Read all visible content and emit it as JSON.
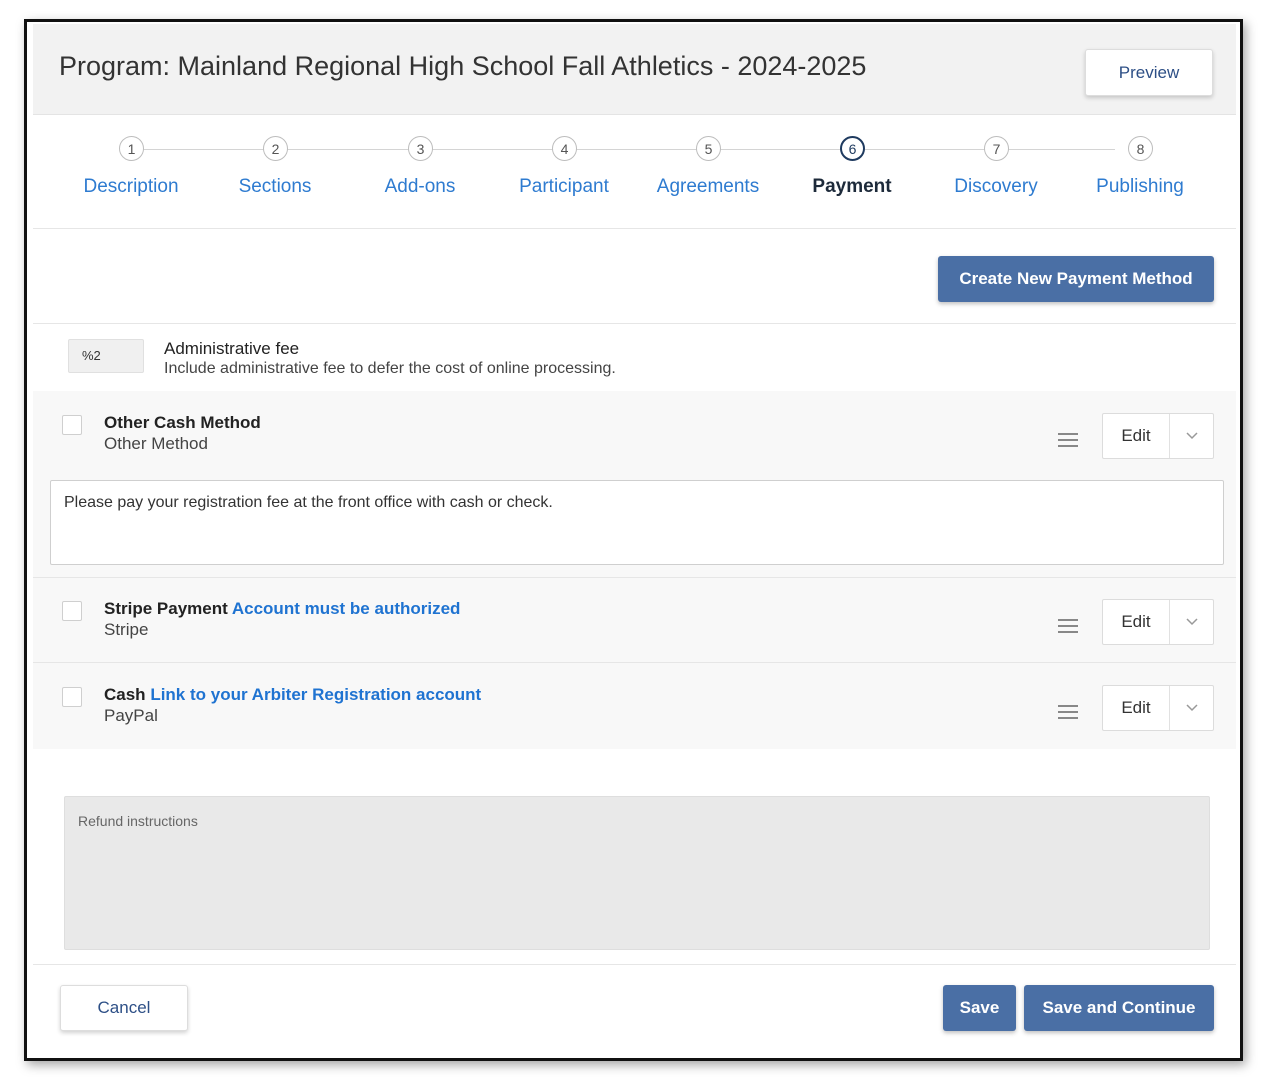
{
  "header": {
    "title": "Program: Mainland Regional High School Fall Athletics - 2024-2025",
    "preview_label": "Preview"
  },
  "steps": [
    {
      "number": "1",
      "label": "Description"
    },
    {
      "number": "2",
      "label": "Sections"
    },
    {
      "number": "3",
      "label": "Add-ons"
    },
    {
      "number": "4",
      "label": "Participant"
    },
    {
      "number": "5",
      "label": "Agreements"
    },
    {
      "number": "6",
      "label": "Payment"
    },
    {
      "number": "7",
      "label": "Discovery"
    },
    {
      "number": "8",
      "label": "Publishing"
    }
  ],
  "active_step": "Payment",
  "create_method_label": "Create New Payment Method",
  "admin_fee": {
    "value": "%2",
    "title": "Administrative fee",
    "description": "Include administrative fee to defer the cost of online processing."
  },
  "methods": [
    {
      "title": "Other Cash Method",
      "link": "",
      "subtitle": "Other Method",
      "edit_label": "Edit",
      "instructions": "Please pay your registration fee at the front office with cash or check."
    },
    {
      "title": "Stripe Payment",
      "link": "Account must be authorized",
      "subtitle": "Stripe",
      "edit_label": "Edit"
    },
    {
      "title": "Cash",
      "link": "Link to your Arbiter Registration account",
      "subtitle": "PayPal",
      "edit_label": "Edit"
    }
  ],
  "refund": {
    "placeholder": "Refund instructions"
  },
  "footer": {
    "cancel_label": "Cancel",
    "save_label": "Save",
    "save_continue_label": "Save and Continue"
  },
  "colors": {
    "primary_button": "#4a6fa5",
    "link": "#1f73d1",
    "step_link": "#2e7bd0",
    "active_step": "#1e3a5f"
  },
  "icons": [
    "drag-handle-icon",
    "chevron-down-icon"
  ]
}
